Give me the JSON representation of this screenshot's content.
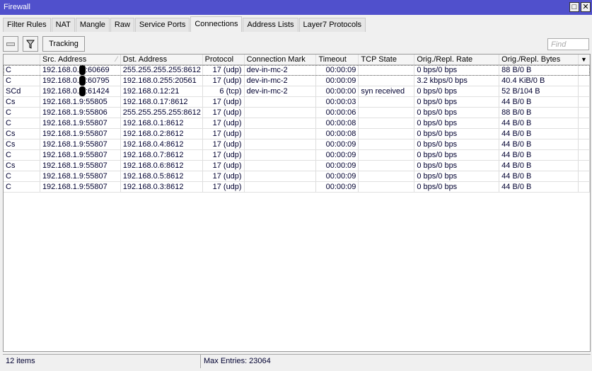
{
  "window": {
    "title": "Firewall"
  },
  "tabs": [
    "Filter Rules",
    "NAT",
    "Mangle",
    "Raw",
    "Service Ports",
    "Connections",
    "Address Lists",
    "Layer7 Protocols"
  ],
  "active_tab": "Connections",
  "toolbar": {
    "tracking_label": "Tracking",
    "find_placeholder": "Find"
  },
  "columns": [
    "",
    "Src. Address",
    "Dst. Address",
    "Protocol",
    "Connection Mark",
    "Timeout",
    "TCP State",
    "Orig./Repl. Rate",
    "Orig./Repl. Bytes"
  ],
  "rows": [
    {
      "flags": "C",
      "src_prefix": "192.168.0.",
      "src_suffix": ":60669",
      "redacted": true,
      "dst": "255.255.255.255:8612",
      "proto": "17 (udp)",
      "mark": "dev-in-mc-2",
      "timeout": "00:00:09",
      "tcp": "",
      "rate": "0 bps/0 bps",
      "bytes": "88 B/0 B"
    },
    {
      "flags": "C",
      "src_prefix": "192.168.0.",
      "src_suffix": ":60795",
      "redacted": true,
      "dst": "192.168.0.255:20561",
      "proto": "17 (udp)",
      "mark": "dev-in-mc-2",
      "timeout": "00:00:09",
      "tcp": "",
      "rate": "3.2 kbps/0 bps",
      "bytes": "40.4 KiB/0 B"
    },
    {
      "flags": "SCd",
      "src_prefix": "192.168.0.",
      "src_suffix": ":61424",
      "redacted": true,
      "dst": "192.168.0.12:21",
      "proto": "6 (tcp)",
      "mark": "dev-in-mc-2",
      "timeout": "00:00:00",
      "tcp": "syn received",
      "rate": "0 bps/0 bps",
      "bytes": "52 B/104 B"
    },
    {
      "flags": "Cs",
      "src_prefix": "192.168.1.9:55805",
      "src_suffix": "",
      "dst": "192.168.0.17:8612",
      "proto": "17 (udp)",
      "mark": "",
      "timeout": "00:00:03",
      "tcp": "",
      "rate": "0 bps/0 bps",
      "bytes": "44 B/0 B"
    },
    {
      "flags": "C",
      "src_prefix": "192.168.1.9:55806",
      "src_suffix": "",
      "dst": "255.255.255.255:8612",
      "proto": "17 (udp)",
      "mark": "",
      "timeout": "00:00:06",
      "tcp": "",
      "rate": "0 bps/0 bps",
      "bytes": "88 B/0 B"
    },
    {
      "flags": "C",
      "src_prefix": "192.168.1.9:55807",
      "src_suffix": "",
      "dst": "192.168.0.1:8612",
      "proto": "17 (udp)",
      "mark": "",
      "timeout": "00:00:08",
      "tcp": "",
      "rate": "0 bps/0 bps",
      "bytes": "44 B/0 B"
    },
    {
      "flags": "Cs",
      "src_prefix": "192.168.1.9:55807",
      "src_suffix": "",
      "dst": "192.168.0.2:8612",
      "proto": "17 (udp)",
      "mark": "",
      "timeout": "00:00:08",
      "tcp": "",
      "rate": "0 bps/0 bps",
      "bytes": "44 B/0 B"
    },
    {
      "flags": "Cs",
      "src_prefix": "192.168.1.9:55807",
      "src_suffix": "",
      "dst": "192.168.0.4:8612",
      "proto": "17 (udp)",
      "mark": "",
      "timeout": "00:00:09",
      "tcp": "",
      "rate": "0 bps/0 bps",
      "bytes": "44 B/0 B"
    },
    {
      "flags": "C",
      "src_prefix": "192.168.1.9:55807",
      "src_suffix": "",
      "dst": "192.168.0.7:8612",
      "proto": "17 (udp)",
      "mark": "",
      "timeout": "00:00:09",
      "tcp": "",
      "rate": "0 bps/0 bps",
      "bytes": "44 B/0 B"
    },
    {
      "flags": "Cs",
      "src_prefix": "192.168.1.9:55807",
      "src_suffix": "",
      "dst": "192.168.0.6:8612",
      "proto": "17 (udp)",
      "mark": "",
      "timeout": "00:00:09",
      "tcp": "",
      "rate": "0 bps/0 bps",
      "bytes": "44 B/0 B"
    },
    {
      "flags": "C",
      "src_prefix": "192.168.1.9:55807",
      "src_suffix": "",
      "dst": "192.168.0.5:8612",
      "proto": "17 (udp)",
      "mark": "",
      "timeout": "00:00:09",
      "tcp": "",
      "rate": "0 bps/0 bps",
      "bytes": "44 B/0 B"
    },
    {
      "flags": "C",
      "src_prefix": "192.168.1.9:55807",
      "src_suffix": "",
      "dst": "192.168.0.3:8612",
      "proto": "17 (udp)",
      "mark": "",
      "timeout": "00:00:09",
      "tcp": "",
      "rate": "0 bps/0 bps",
      "bytes": "44 B/0 B"
    }
  ],
  "status": {
    "items": "12 items",
    "max_entries": "Max Entries: 23064"
  }
}
